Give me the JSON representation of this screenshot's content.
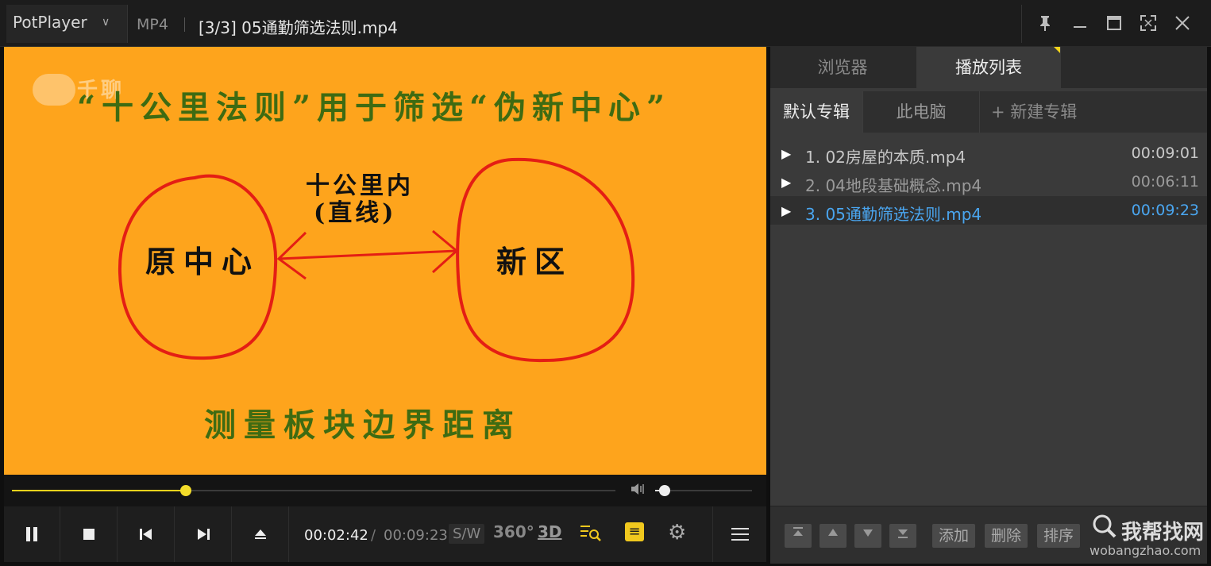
{
  "titlebar": {
    "app_name": "PotPlayer",
    "format": "MP4",
    "file_title": "[3/3] 05通勤筛选法则.mp4",
    "pin_icon": "pin-icon",
    "minimize_icon": "minimize-icon",
    "maximize_icon": "maximize-icon",
    "fullscreen_icon": "fullscreen-icon",
    "close_icon": "close-icon"
  },
  "video": {
    "watermark": "千聊",
    "title": "“十公里法则”用于筛选“伪新中心”",
    "left_circle_label": "原中心",
    "right_circle_label": "新区",
    "arrow_label_line1": "十公里内",
    "arrow_label_line2": "(直线)",
    "bottom_text": "测量板块边界距离",
    "background_color": "#fea41c"
  },
  "playback": {
    "progress_fraction": 0.2877,
    "volume_fraction": 0.1,
    "current_time": "00:02:42",
    "separator": "/",
    "total_time": "00:09:23",
    "sw_label": "S/W",
    "v360_label": "360°",
    "v3d_label": "3D",
    "accent_color": "#f0d21c"
  },
  "panel": {
    "tabs": [
      "浏览器",
      "播放列表"
    ],
    "active_tab": "播放列表",
    "album_tabs": [
      "默认专辑",
      "此电脑",
      "+ 新建专辑"
    ],
    "playlist": [
      {
        "name": "1. 02房屋的本质.mp4",
        "duration": "00:09:01",
        "state": "played"
      },
      {
        "name": "2. 04地段基础概念.mp4",
        "duration": "00:06:11",
        "state": "normal"
      },
      {
        "name": "3. 05通勤筛选法则.mp4",
        "duration": "00:09:23",
        "state": "playing"
      }
    ],
    "bottom_buttons": [
      "添加",
      "删除",
      "排序"
    ],
    "playing_color": "#4aa6f0"
  },
  "watermark_site": {
    "cn": "我帮找网",
    "en": "wobangzhao.com"
  }
}
